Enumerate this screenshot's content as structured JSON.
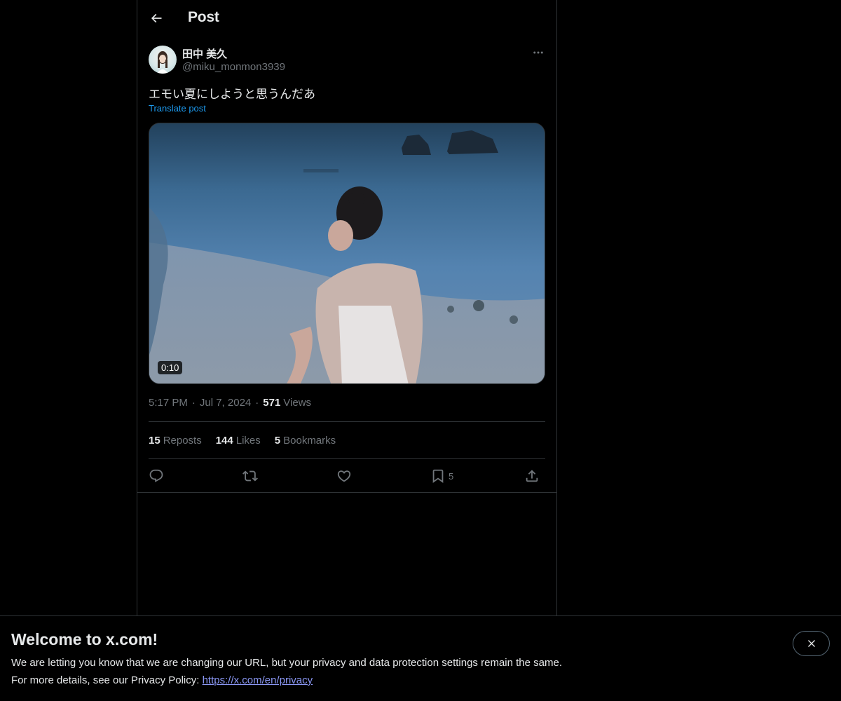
{
  "header": {
    "title": "Post",
    "back_icon": "back-arrow-icon"
  },
  "post": {
    "author_name": "田中 美久",
    "author_handle": "@miku_monmon3939",
    "text": "エモい夏にしようと思うんだあ",
    "translate_label": "Translate post",
    "media": {
      "type": "video",
      "duration": "0:10"
    },
    "time": "5:17 PM",
    "date": "Jul 7, 2024",
    "views_count": "571",
    "views_label": "Views",
    "separator": "·",
    "stats": {
      "reposts_count": "15",
      "reposts_label": "Reposts",
      "likes_count": "144",
      "likes_label": "Likes",
      "bookmarks_count": "5",
      "bookmarks_label": "Bookmarks"
    },
    "actions": {
      "bookmark_count": "5"
    }
  },
  "banner": {
    "title": "Welcome to x.com!",
    "line1": "We are letting you know that we are changing our URL, but your privacy and data protection settings remain the same.",
    "line2_prefix": "For more details, see our Privacy Policy: ",
    "link_text": "https://x.com/en/privacy"
  },
  "colors": {
    "background": "#000000",
    "text": "#e7e9ea",
    "muted": "#71767b",
    "accent": "#1d9bf0",
    "border": "#2f3336"
  }
}
